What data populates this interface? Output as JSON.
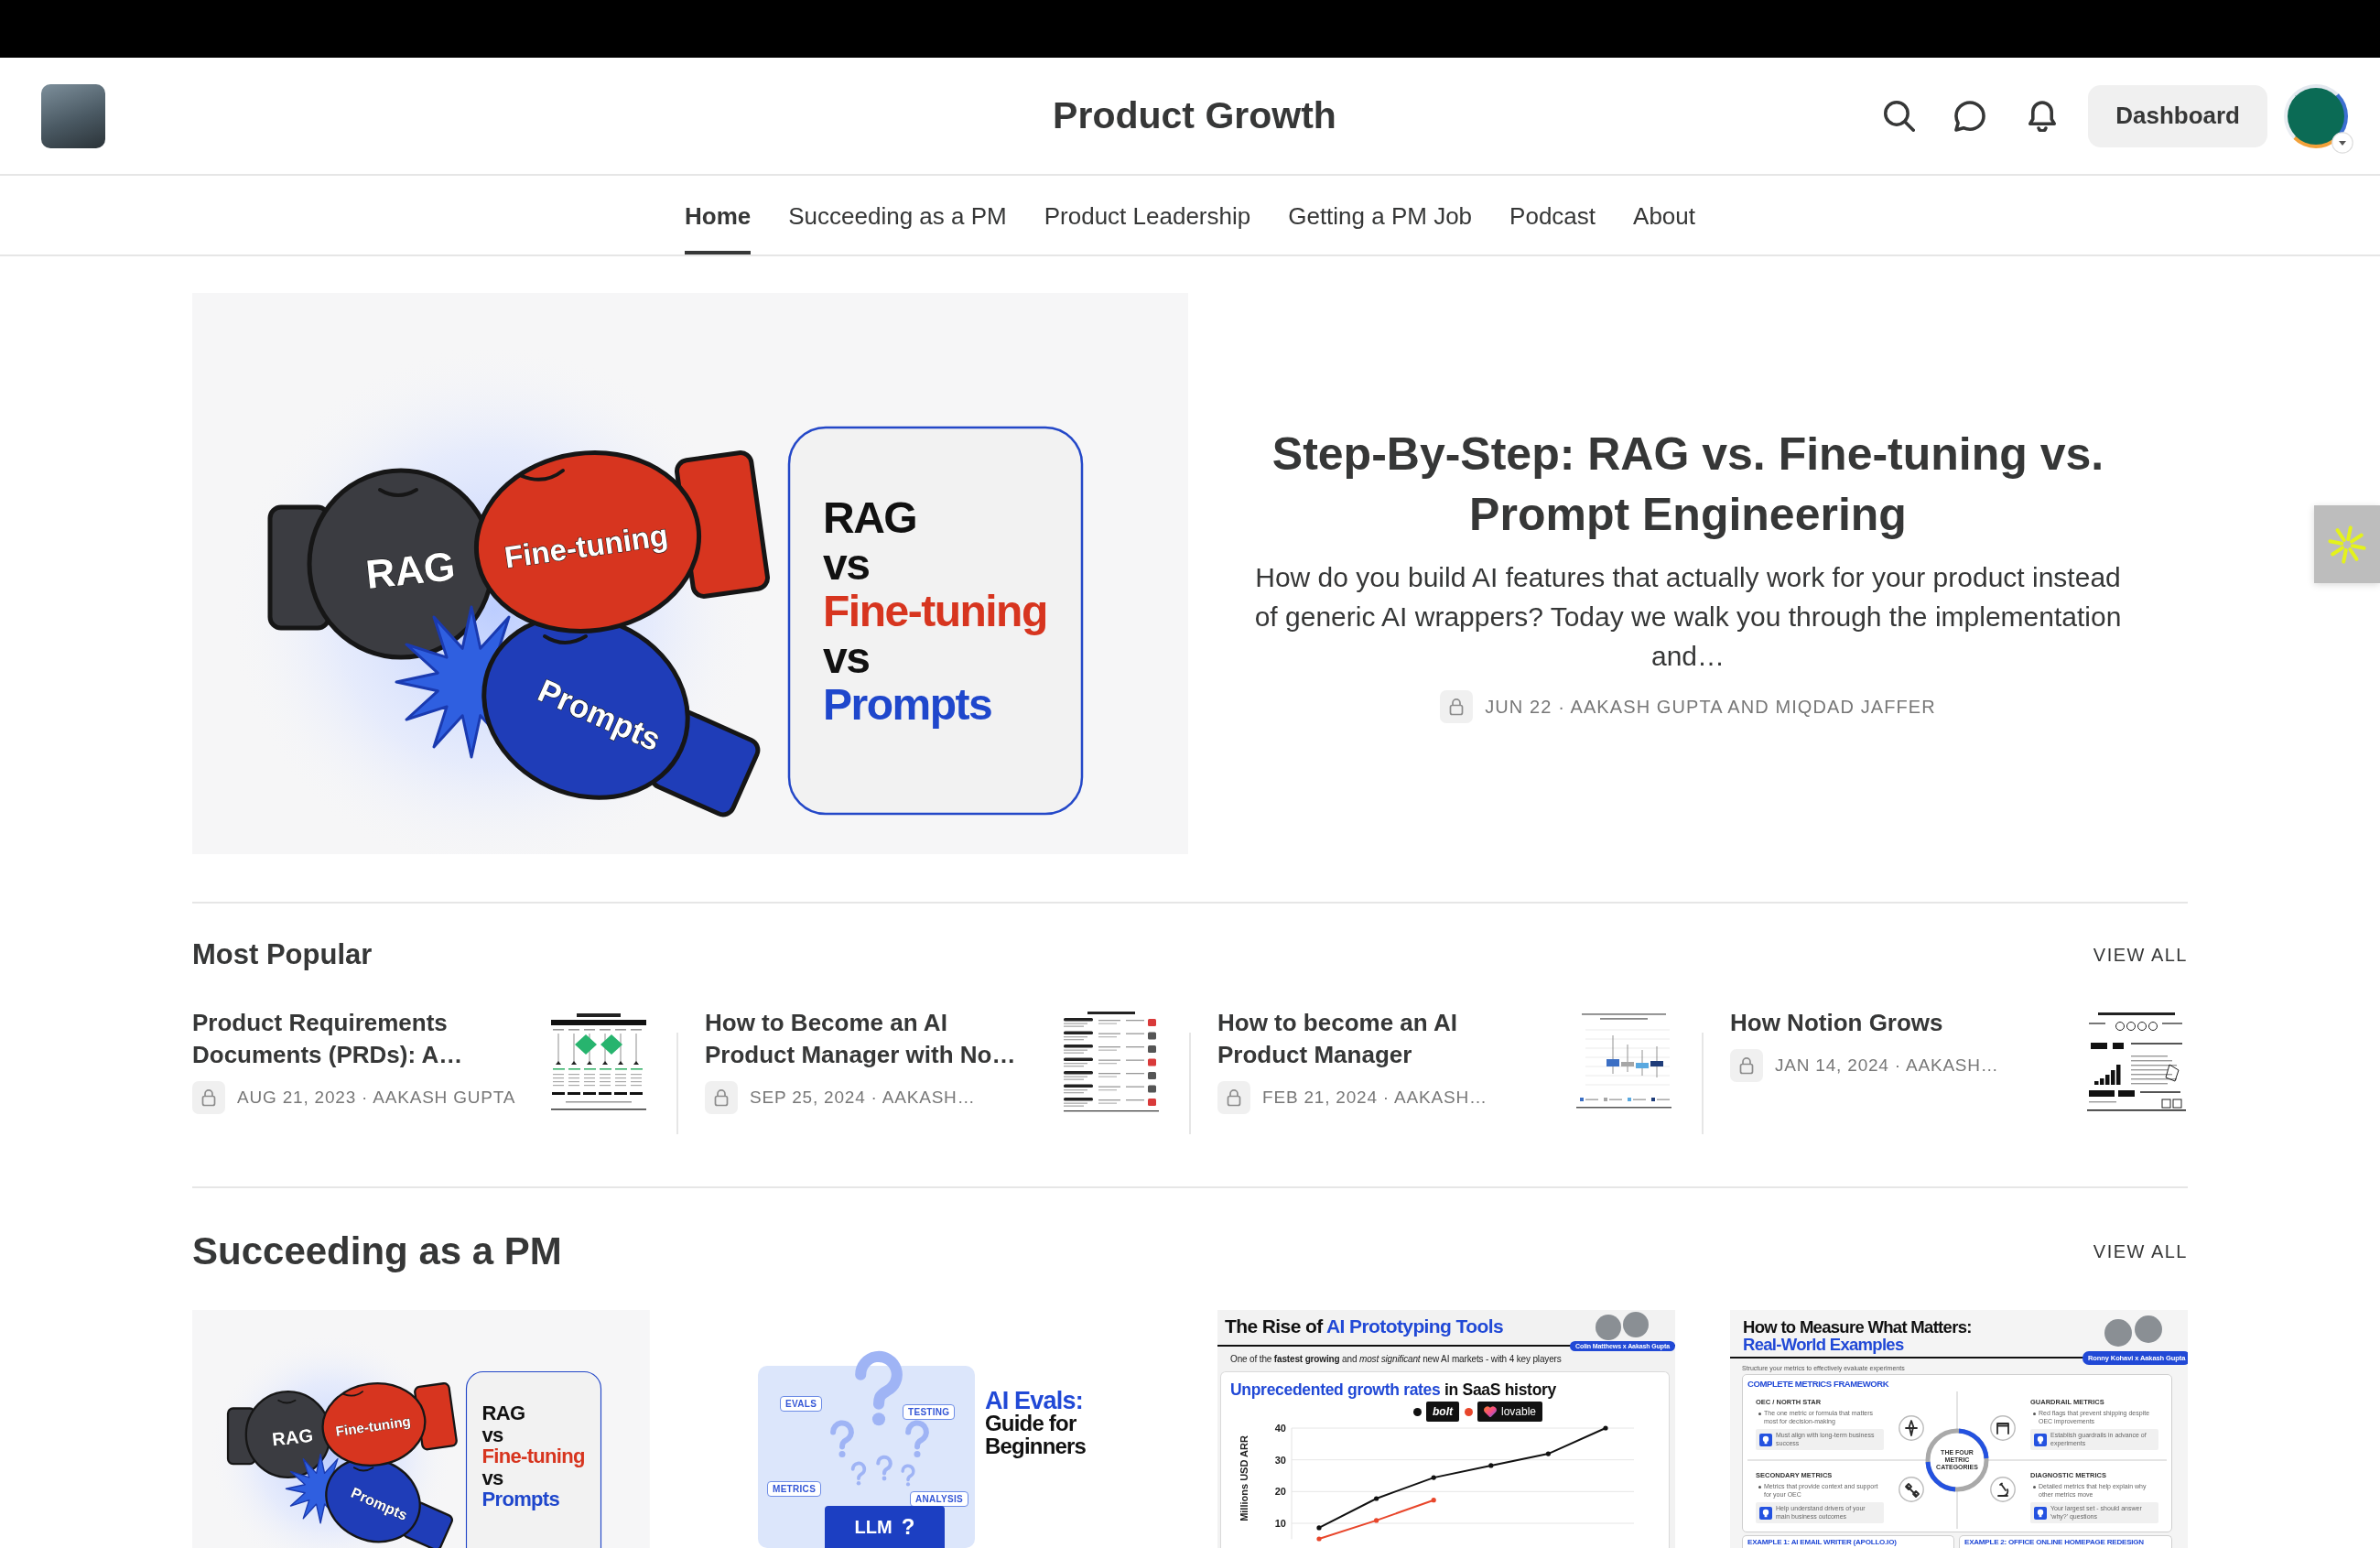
{
  "header": {
    "title": "Product Growth",
    "dashboard_button": "Dashboard"
  },
  "nav": [
    {
      "label": "Home",
      "selected": true
    },
    {
      "label": "Succeeding as a PM",
      "selected": false
    },
    {
      "label": "Product Leadership",
      "selected": false
    },
    {
      "label": "Getting a PM Job",
      "selected": false
    },
    {
      "label": "Podcast",
      "selected": false
    },
    {
      "label": "About",
      "selected": false
    }
  ],
  "hero": {
    "image": {
      "kind": "versus",
      "gloves": [
        {
          "label": "RAG",
          "color": "#3b3c41"
        },
        {
          "label": "Fine-tuning",
          "color": "#d7351f"
        },
        {
          "label": "Prompts",
          "color": "#1f3db8"
        }
      ],
      "card_lines": [
        {
          "text": "RAG",
          "color": "#111111"
        },
        {
          "text": "vs",
          "color": "#111111"
        },
        {
          "text": "Fine-tuning",
          "color": "#d7351f"
        },
        {
          "text": "vs",
          "color": "#111111"
        },
        {
          "text": "Prompts",
          "color": "#1f47cc"
        }
      ]
    },
    "title": "Step-By-Step: RAG vs. Fine-tuning vs. Prompt Engineering",
    "description": "How do you build AI features that actually work for your product instead of generic AI wrappers? Today we walk you through the implementation and…",
    "locked": true,
    "meta": "JUN 22 · AAKASH GUPTA AND MIQDAD JAFFER"
  },
  "most_popular": {
    "heading": "Most Popular",
    "view_all": "VIEW ALL",
    "posts": [
      {
        "title": "Product Requirements Documents (PRDs): A…",
        "locked": true,
        "meta": "AUG 21, 2023 · AAKASH GUPTA",
        "thumbnail": {
          "kind": "flowchart"
        }
      },
      {
        "title": "How to Become an AI Product Manager with No…",
        "locked": true,
        "meta": "SEP 25, 2024 · AAKASH…",
        "thumbnail": {
          "kind": "checklist"
        }
      },
      {
        "title": "How to become an AI Product Manager",
        "locked": true,
        "meta": "FEB 21, 2024 · AAKASH…",
        "thumbnail": {
          "kind": "box_plot"
        }
      },
      {
        "title": "How Notion Grows",
        "locked": true,
        "meta": "JAN 14, 2024 · AAKASH…",
        "thumbnail": {
          "kind": "stats"
        }
      }
    ]
  },
  "succeeding": {
    "heading": "Succeeding as a PM",
    "view_all": "VIEW ALL",
    "posts": [
      {
        "image": {
          "kind": "versus",
          "gloves": [
            {
              "label": "RAG",
              "color": "#3b3c41"
            },
            {
              "label": "Fine-tuning",
              "color": "#d7351f"
            },
            {
              "label": "Prompts",
              "color": "#1f3db8"
            }
          ],
          "card_lines": [
            {
              "text": "RAG",
              "color": "#111111"
            },
            {
              "text": "vs",
              "color": "#111111"
            },
            {
              "text": "Fine-tuning",
              "color": "#d7351f"
            },
            {
              "text": "vs",
              "color": "#111111"
            },
            {
              "text": "Prompts",
              "color": "#1f47cc"
            }
          ]
        }
      },
      {
        "image": {
          "kind": "evals",
          "title": "AI Evals:",
          "subtitle": "Guide for Beginners",
          "tags": [
            "EVALS",
            "TESTING",
            "METRICS",
            "ANALYSIS"
          ],
          "box_label": "LLM",
          "box_mark": "?"
        }
      },
      {
        "image": {
          "kind": "chart",
          "title": "The Rise of",
          "title_highlight": "AI Prototyping Tools",
          "byline": "Colin Matthews x Aakash Gupta",
          "subtitle": "One of the **fastest growing** and *most significant* new AI markets - with 4 key players",
          "chart_title_highlight": "Unprecedented growth rates",
          "chart_title": "in SaaS history",
          "legend_badges": [
            {
              "kind": "wordmark"
            },
            {
              "kind": "heart"
            }
          ],
          "chart_data": {
            "type": "line",
            "ylabel": "Millions USD ARR",
            "ylim": [
              5,
              40
            ],
            "yticks": [
              10,
              20,
              30,
              40
            ],
            "grid": true,
            "legend": "top",
            "series": [
              {
                "name": "bolt",
                "color": "#111111",
                "values": [
                  8.6,
                  17.8,
                  24.4,
                  28.2,
                  31.9,
                  40
                ]
              },
              {
                "name": "lovable",
                "color": "#e8462b",
                "values": [
                  5.1,
                  10.9,
                  17.3,
                  null,
                  null,
                  null
                ]
              }
            ]
          }
        }
      },
      {
        "image": {
          "kind": "metrics",
          "title": "How to Measure What Matters:",
          "title_highlight": "Real-World Examples",
          "byline": "Ronny Kohavi x Aakash Gupta",
          "intro": "Structure your metrics to effectively evaluate experiments",
          "panel_heading": "COMPLETE METRICS FRAMEWORK",
          "center_label": "THE FOUR METRIC CATEGORIES",
          "categories": [
            {
              "name": "OEC / NORTH STAR",
              "description": "The one metric or formula that matters most for decision-making",
              "tip": "Must align with long-term business success"
            },
            {
              "name": "GUARDRAIL METRICS",
              "description": "Red flags that prevent shipping despite OEC improvements",
              "tip": "Establish guardrails in advance of experiments"
            },
            {
              "name": "SECONDARY METRICS",
              "description": "Metrics that provide context and support for your OEC",
              "tip": "Help understand drivers of your main business outcomes"
            },
            {
              "name": "DIAGNOSTIC METRICS",
              "description": "Detailed metrics that help explain why other metrics move",
              "tip": "Your largest set - should answer 'why?' questions"
            }
          ],
          "examples": [
            "EXAMPLE 1: AI EMAIL WRITER (APOLLO.IO)",
            "EXAMPLE 2: OFFICE ONLINE HOMEPAGE REDESIGN"
          ]
        }
      }
    ]
  }
}
